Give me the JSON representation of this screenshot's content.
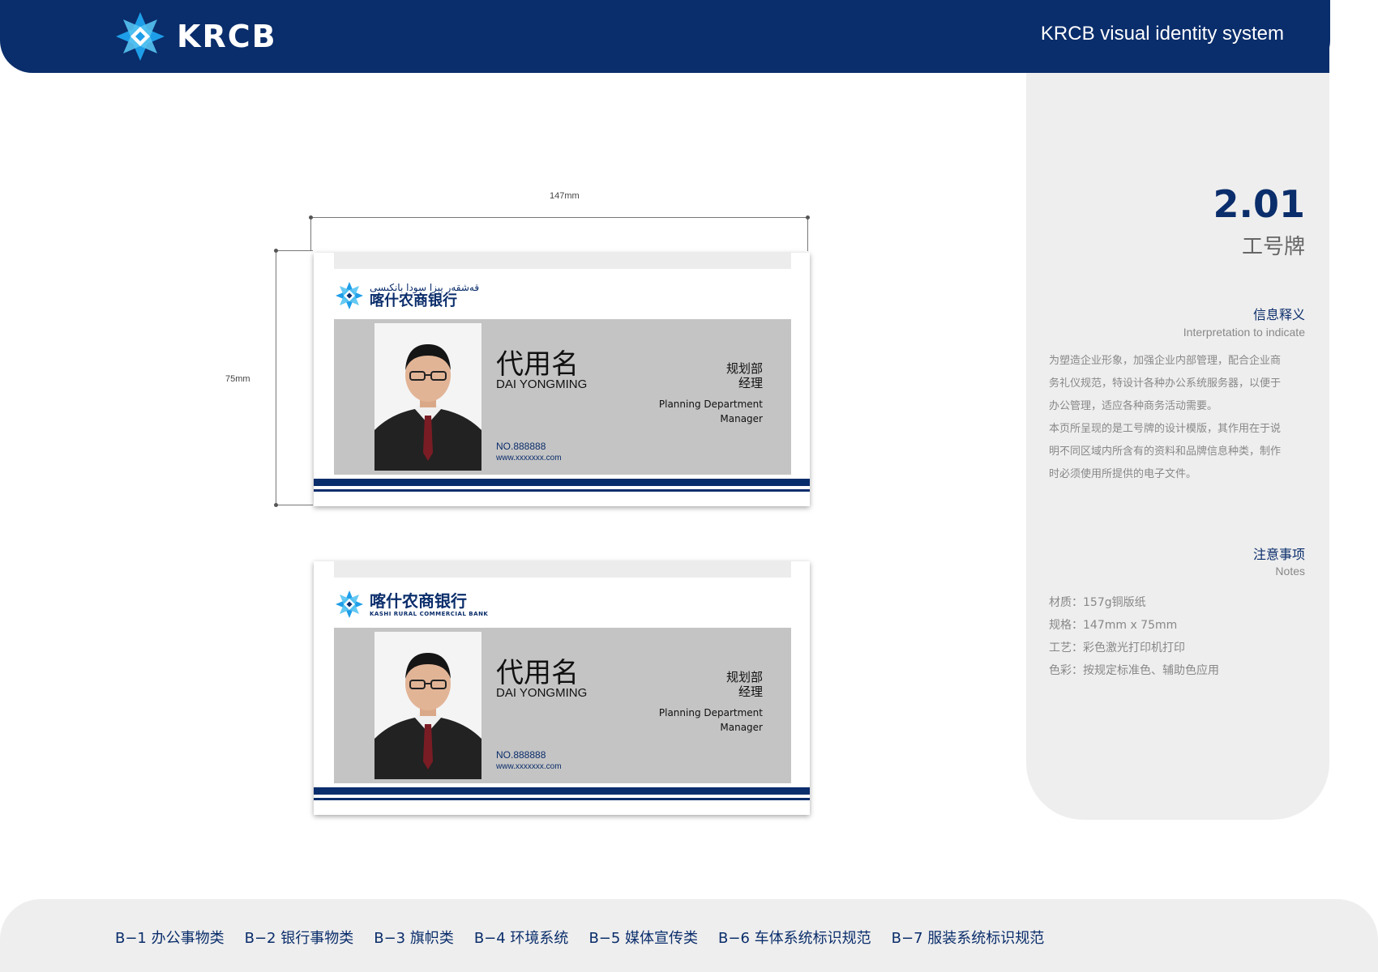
{
  "header": {
    "brand": "KRCB",
    "title": "KRCB visual identity system"
  },
  "dimensions": {
    "width": "147mm",
    "height": "75mm"
  },
  "cards": [
    {
      "logo_line1": "قەشقەر يېزا سودا بانكىسى",
      "logo_line2": "喀什农商银行",
      "name_cn": "代用名",
      "name_en": "DAI YONGMING",
      "dept_cn_1": "规划部",
      "dept_cn_2": "经理",
      "dept_en_1": "Planning Department",
      "dept_en_2": "Manager",
      "number": "NO.888888",
      "website": "www.xxxxxxx.com"
    },
    {
      "logo_line1": "喀什农商银行",
      "logo_line2": "KASHI RURAL COMMERCIAL BANK",
      "name_cn": "代用名",
      "name_en": "DAI YONGMING",
      "dept_cn_1": "规划部",
      "dept_cn_2": "经理",
      "dept_en_1": "Planning Department",
      "dept_en_2": "Manager",
      "number": "NO.888888",
      "website": "www.xxxxxxx.com"
    }
  ],
  "panel": {
    "section_number": "2.01",
    "section_title": "工号牌",
    "info_title": "信息释义",
    "info_subtitle": "Interpretation to indicate",
    "info_lines": [
      "为塑造企业形象，加强企业内部管理，配合企业商",
      "务礼仪规范，特设计各种办公系统服务器，以便于",
      "办公管理，适应各种商务活动需要。",
      "本页所呈现的是工号牌的设计模版，其作用在于说",
      "明不同区域内所含有的资料和品牌信息种类，制作",
      "时必须使用所提供的电子文件。"
    ],
    "notes_title": "注意事项",
    "notes_subtitle": "Notes",
    "notes": [
      "材质：157g铜版纸",
      "规格：147mm x 75mm",
      "工艺：彩色激光打印机打印",
      "色彩：按规定标准色、辅助色应用"
    ]
  },
  "footer_nav": [
    "B−1 办公事物类",
    "B−2 银行事物类",
    "B−3 旗帜类",
    "B−4 环境系统",
    "B−5 媒体宣传类",
    "B−6 车体系统标识规范",
    "B−7 服装系统标识规范"
  ],
  "colors": {
    "brand_navy": "#0a2d6b",
    "brand_blue": "#1e9ee8",
    "card_gray": "#c4c4c4",
    "panel_gray": "#eeeeee"
  },
  "icons": [
    "krcb-flower-logo-icon",
    "person-photo"
  ]
}
